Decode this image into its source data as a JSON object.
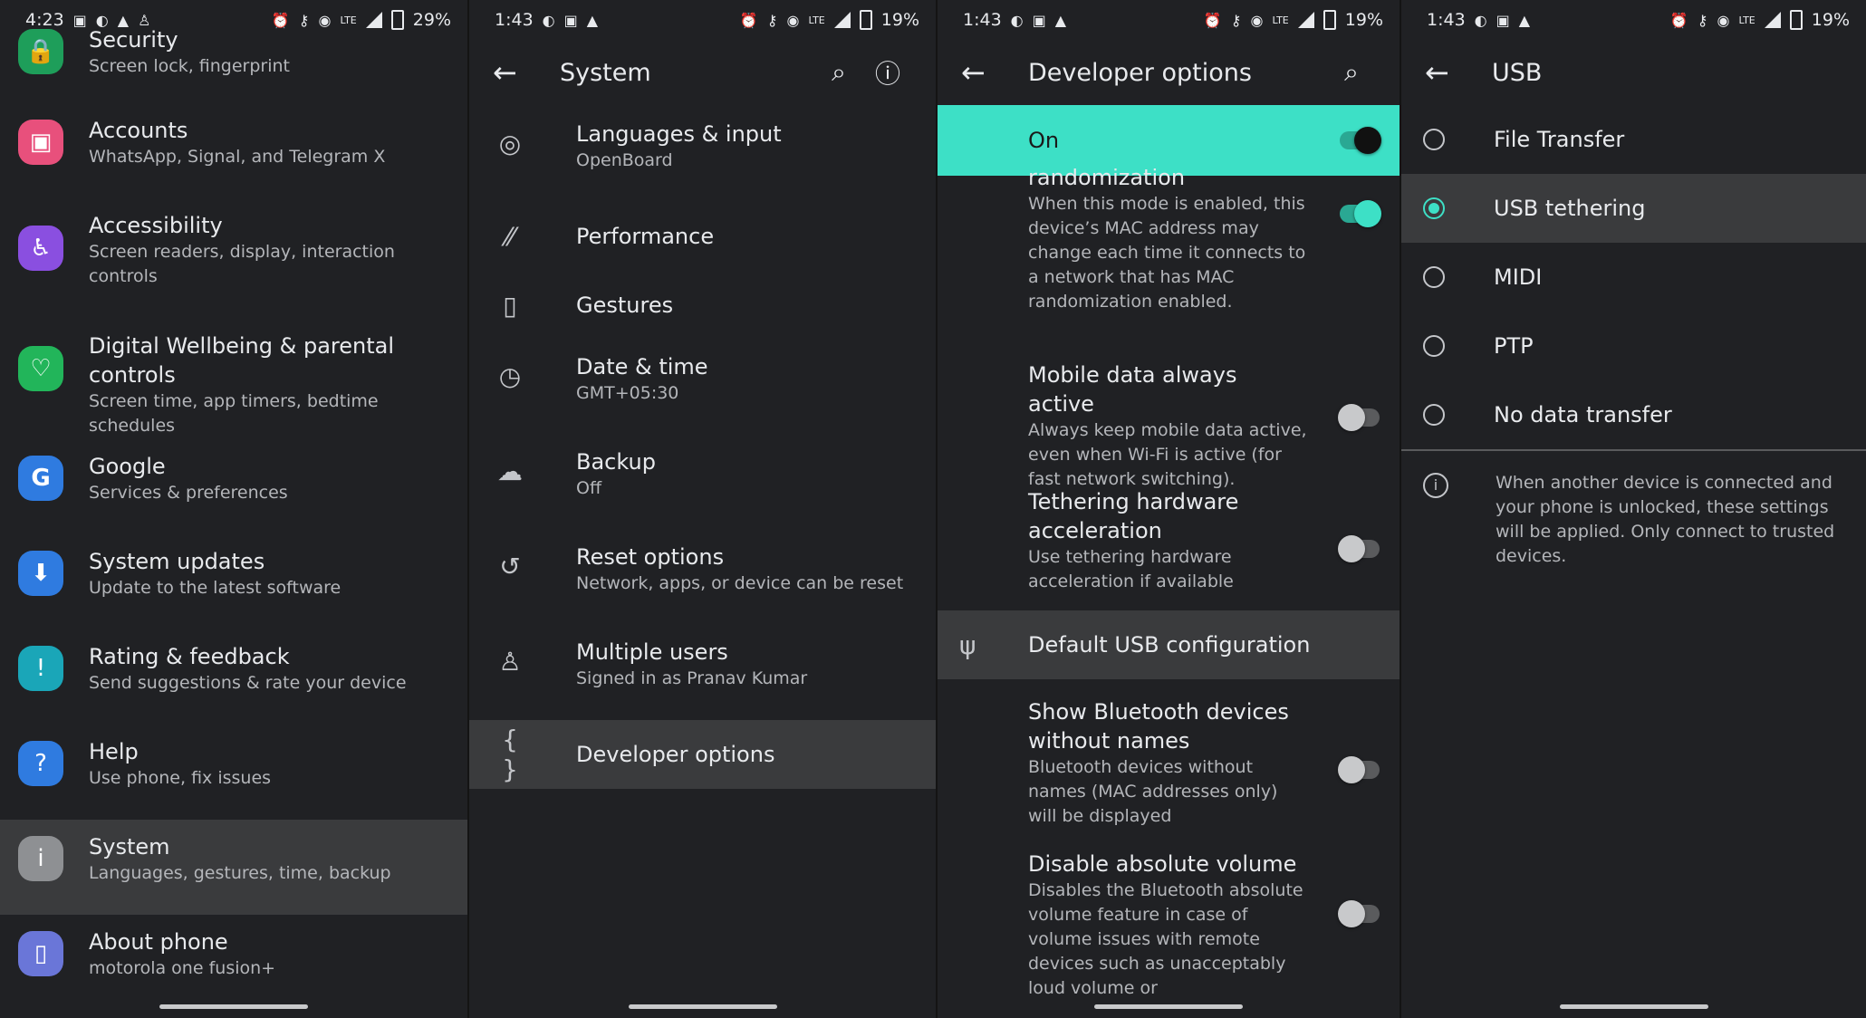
{
  "screen1": {
    "status": {
      "time": "4:23",
      "battery": "29%",
      "network": "LTE"
    },
    "items": [
      {
        "title": "Security",
        "subtitle": "Screen lock, fingerprint",
        "icon": "lock-icon",
        "color": "#1e9e5a"
      },
      {
        "title": "Accounts",
        "subtitle": "WhatsApp, Signal, and Telegram X",
        "icon": "account-icon",
        "color": "#e8507c"
      },
      {
        "title": "Accessibility",
        "subtitle": "Screen readers, display, interaction controls",
        "icon": "accessibility-icon",
        "color": "#8a4fe0"
      },
      {
        "title": "Digital Wellbeing & parental controls",
        "subtitle": "Screen time, app timers, bedtime schedules",
        "icon": "wellbeing-icon",
        "color": "#22b55a"
      },
      {
        "title": "Google",
        "subtitle": "Services & preferences",
        "icon": "google-icon",
        "color": "#2f7be0"
      },
      {
        "title": "System updates",
        "subtitle": "Update to the latest software",
        "icon": "system-update-icon",
        "color": "#2f7be0"
      },
      {
        "title": "Rating & feedback",
        "subtitle": "Send suggestions & rate your device",
        "icon": "feedback-icon",
        "color": "#1aa6b8"
      },
      {
        "title": "Help",
        "subtitle": "Use phone, fix issues",
        "icon": "help-icon",
        "color": "#2f7be0"
      },
      {
        "title": "System",
        "subtitle": "Languages, gestures, time, backup",
        "icon": "info-icon",
        "color": "#8e9093"
      },
      {
        "title": "About phone",
        "subtitle": "motorola one fusion+",
        "icon": "phone-icon",
        "color": "#6a76d8"
      }
    ]
  },
  "screen2": {
    "status": {
      "time": "1:43",
      "battery": "19%",
      "network": "LTE"
    },
    "title": "System",
    "items": [
      {
        "title": "Languages & input",
        "subtitle": "OpenBoard",
        "icon": "globe-icon"
      },
      {
        "title": "Performance",
        "subtitle": "",
        "icon": "performance-icon"
      },
      {
        "title": "Gestures",
        "subtitle": "",
        "icon": "gestures-icon"
      },
      {
        "title": "Date & time",
        "subtitle": "GMT+05:30",
        "icon": "clock-icon"
      },
      {
        "title": "Backup",
        "subtitle": "Off",
        "icon": "cloud-upload-icon"
      },
      {
        "title": "Reset options",
        "subtitle": "Network, apps, or device can be reset",
        "icon": "history-icon"
      },
      {
        "title": "Multiple users",
        "subtitle": "Signed in as Pranav Kumar",
        "icon": "person-icon"
      },
      {
        "title": "Developer options",
        "subtitle": "",
        "icon": "code-braces-icon"
      }
    ]
  },
  "screen3": {
    "status": {
      "time": "1:43",
      "battery": "19%",
      "network": "LTE"
    },
    "title": "Developer options",
    "master_label": "On",
    "partial_title": "randomization",
    "partial_desc": "When this mode is enabled, this device’s MAC address may change each time it connects to a network that has MAC randomization enabled.",
    "items": [
      {
        "title": "Mobile data always active",
        "desc": "Always keep mobile data active, even when Wi-Fi is active (for fast network switching).",
        "on": false
      },
      {
        "title": "Tethering hardware acceleration",
        "desc": "Use tethering hardware acceleration if available",
        "on": false
      }
    ],
    "usb_row": "Default USB configuration",
    "items2": [
      {
        "title": "Show Bluetooth devices without names",
        "desc": "Bluetooth devices without names (MAC addresses only) will be displayed",
        "on": false
      },
      {
        "title": "Disable absolute volume",
        "desc": "Disables the Bluetooth absolute volume feature in case of volume issues with remote devices such as unacceptably loud volume or",
        "on": false
      }
    ]
  },
  "screen4": {
    "status": {
      "time": "1:43",
      "battery": "19%",
      "network": "LTE"
    },
    "title": "USB",
    "options": [
      "File Transfer",
      "USB tethering",
      "MIDI",
      "PTP",
      "No data transfer"
    ],
    "selected_index": 1,
    "info": "When another device is connected and your phone is unlocked, these settings will be applied. Only connect to trusted devices."
  }
}
